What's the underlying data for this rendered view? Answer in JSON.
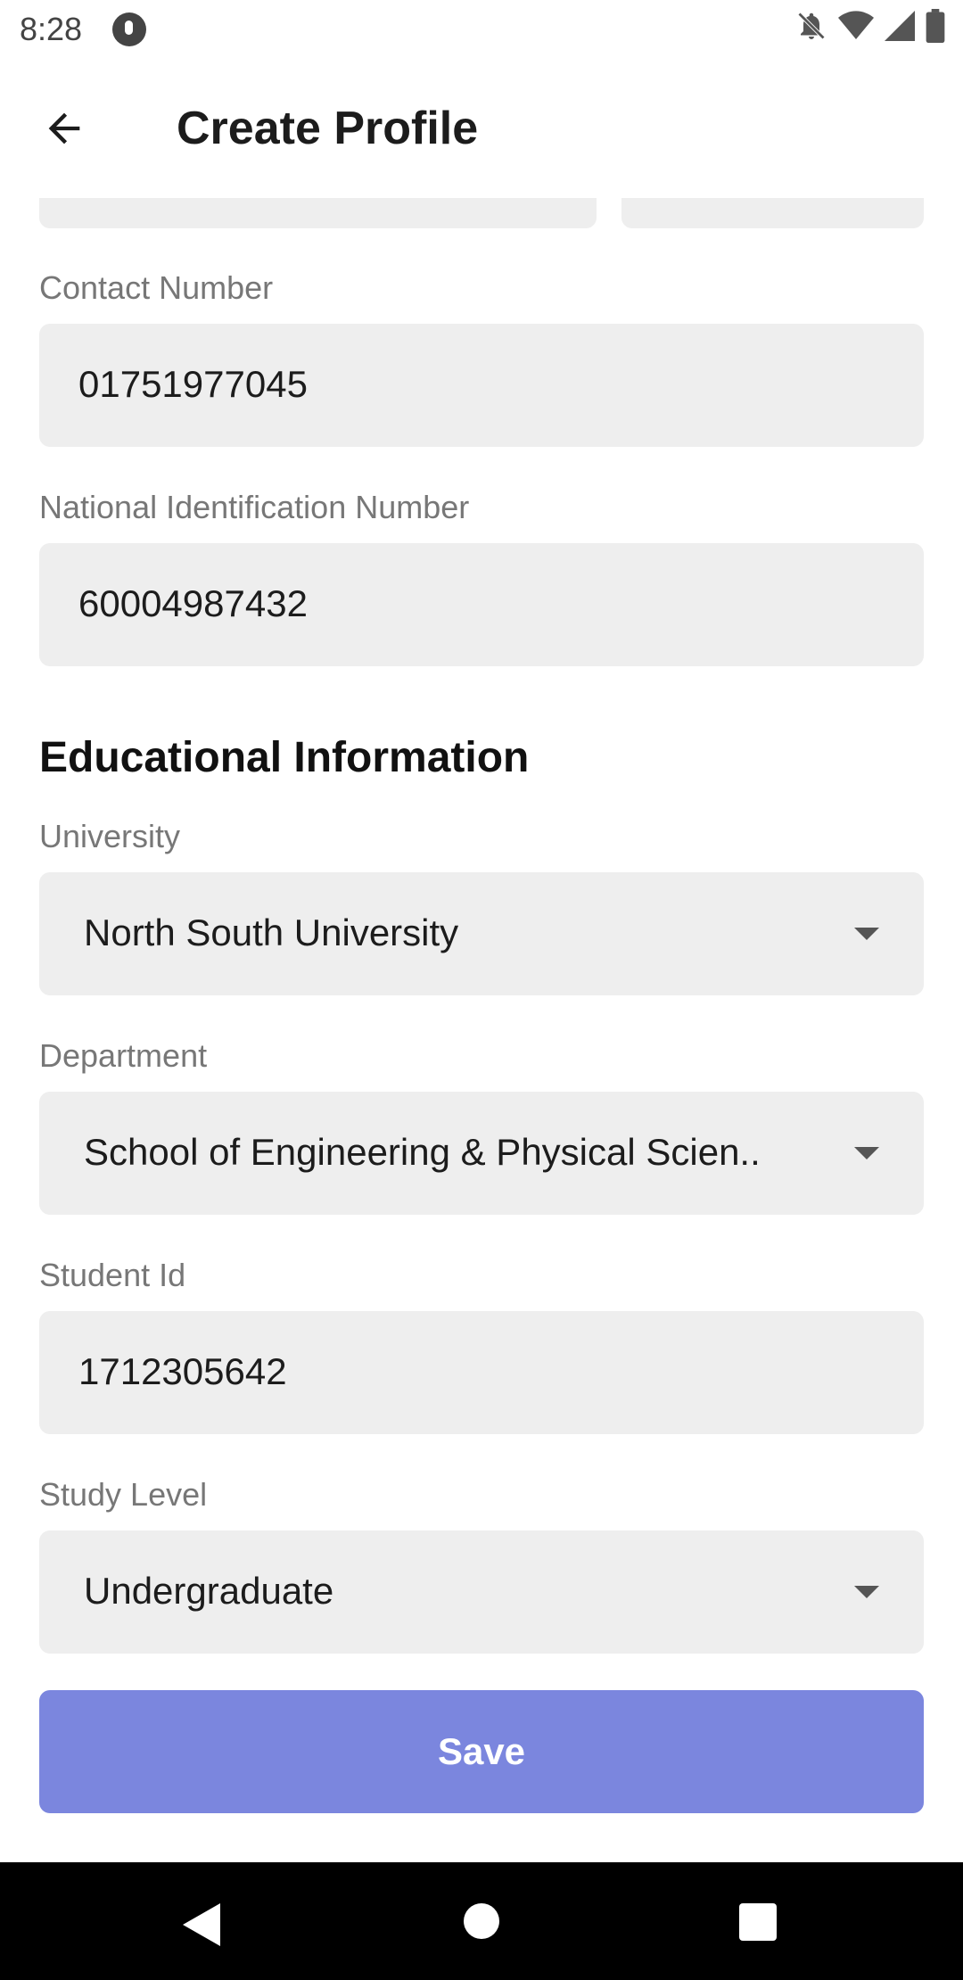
{
  "status_bar": {
    "time": "8:28",
    "icons": [
      "app-notification-icon",
      "notifications-off-icon",
      "wifi-icon",
      "signal-icon",
      "battery-icon"
    ]
  },
  "app_bar": {
    "title": "Create Profile",
    "back_icon": "arrow-back-icon"
  },
  "form": {
    "contact_number": {
      "label": "Contact Number",
      "value": "01751977045"
    },
    "national_id": {
      "label": "National Identification Number",
      "value": "60004987432"
    },
    "educational_section": {
      "title": "Educational Information",
      "university": {
        "label": "University",
        "value": "North South University"
      },
      "department": {
        "label": "Department",
        "value": "School of Engineering & Physical Scien.."
      },
      "student_id": {
        "label": "Student Id",
        "value": "1712305642"
      },
      "study_level": {
        "label": "Study Level",
        "value": "Undergraduate"
      }
    },
    "save_label": "Save"
  },
  "colors": {
    "field_bg": "#eeeeee",
    "save_button": "#7b86de",
    "label_text": "#777777"
  },
  "nav_bar": {
    "icons": [
      "nav-back-icon",
      "nav-home-icon",
      "nav-recents-icon"
    ]
  }
}
